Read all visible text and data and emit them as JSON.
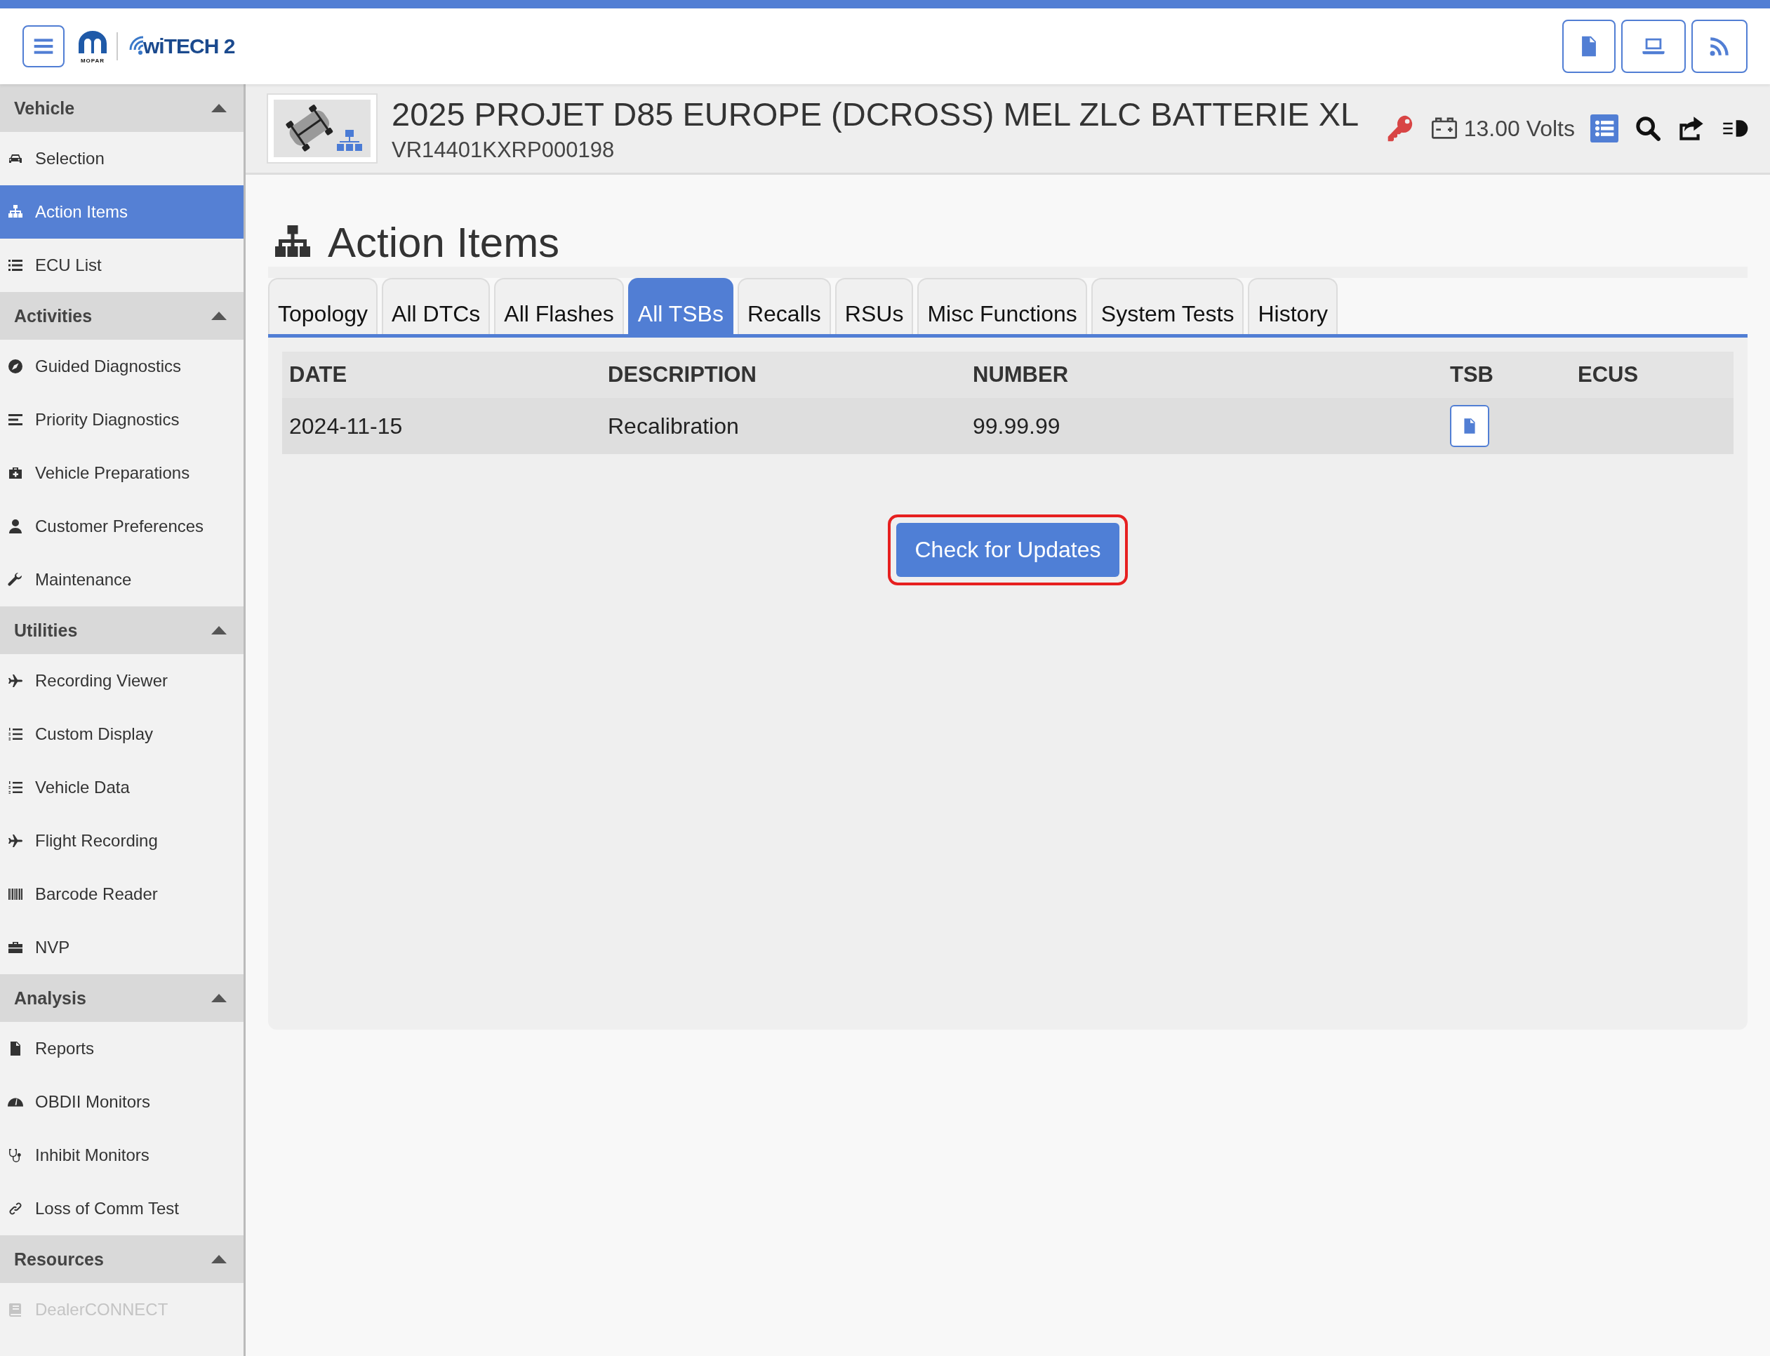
{
  "header": {
    "logo": {
      "brand": "MOPAR",
      "product": "wiTECH 2"
    }
  },
  "sidebar": {
    "sections": [
      {
        "title": "Vehicle",
        "expanded": true,
        "items": [
          {
            "label": "Selection",
            "selected": false,
            "disabled": false
          },
          {
            "label": "Action Items",
            "selected": true,
            "disabled": false
          },
          {
            "label": "ECU List",
            "selected": false,
            "disabled": false
          }
        ]
      },
      {
        "title": "Activities",
        "expanded": true,
        "items": [
          {
            "label": "Guided Diagnostics",
            "selected": false,
            "disabled": false
          },
          {
            "label": "Priority Diagnostics",
            "selected": false,
            "disabled": false
          },
          {
            "label": "Vehicle Preparations",
            "selected": false,
            "disabled": false
          },
          {
            "label": "Customer Preferences",
            "selected": false,
            "disabled": false
          },
          {
            "label": "Maintenance",
            "selected": false,
            "disabled": false
          }
        ]
      },
      {
        "title": "Utilities",
        "expanded": true,
        "items": [
          {
            "label": "Recording Viewer",
            "selected": false,
            "disabled": false
          },
          {
            "label": "Custom Display",
            "selected": false,
            "disabled": false
          },
          {
            "label": "Vehicle Data",
            "selected": false,
            "disabled": false
          },
          {
            "label": "Flight Recording",
            "selected": false,
            "disabled": false
          },
          {
            "label": "Barcode Reader",
            "selected": false,
            "disabled": false
          },
          {
            "label": "NVP",
            "selected": false,
            "disabled": false
          }
        ]
      },
      {
        "title": "Analysis",
        "expanded": true,
        "items": [
          {
            "label": "Reports",
            "selected": false,
            "disabled": false
          },
          {
            "label": "OBDII Monitors",
            "selected": false,
            "disabled": false
          },
          {
            "label": "Inhibit Monitors",
            "selected": false,
            "disabled": false
          },
          {
            "label": "Loss of Comm Test",
            "selected": false,
            "disabled": false
          }
        ]
      },
      {
        "title": "Resources",
        "expanded": true,
        "items": [
          {
            "label": "DealerCONNECT",
            "selected": false,
            "disabled": true
          }
        ]
      }
    ]
  },
  "vehicle": {
    "title": "2025 PROJET D85 EUROPE (DCROSS) MEL ZLC BATTERIE XL",
    "vin": "VR14401KXRP000198",
    "voltage": "13.00 Volts"
  },
  "page": {
    "title": "Action Items"
  },
  "tabs": [
    {
      "label": "Topology",
      "selected": false
    },
    {
      "label": "All DTCs",
      "selected": false
    },
    {
      "label": "All Flashes",
      "selected": false
    },
    {
      "label": "All TSBs",
      "selected": true
    },
    {
      "label": "Recalls",
      "selected": false
    },
    {
      "label": "RSUs",
      "selected": false
    },
    {
      "label": "Misc Functions",
      "selected": false
    },
    {
      "label": "System Tests",
      "selected": false
    },
    {
      "label": "History",
      "selected": false
    }
  ],
  "table": {
    "columns": [
      "DATE",
      "DESCRIPTION",
      "NUMBER",
      "TSB",
      "ECUS"
    ],
    "rows": [
      {
        "date": "2024-11-15",
        "description": "Recalibration",
        "number": "99.99.99"
      }
    ]
  },
  "update_button": {
    "label": "Check for Updates",
    "highlighted": true
  }
}
